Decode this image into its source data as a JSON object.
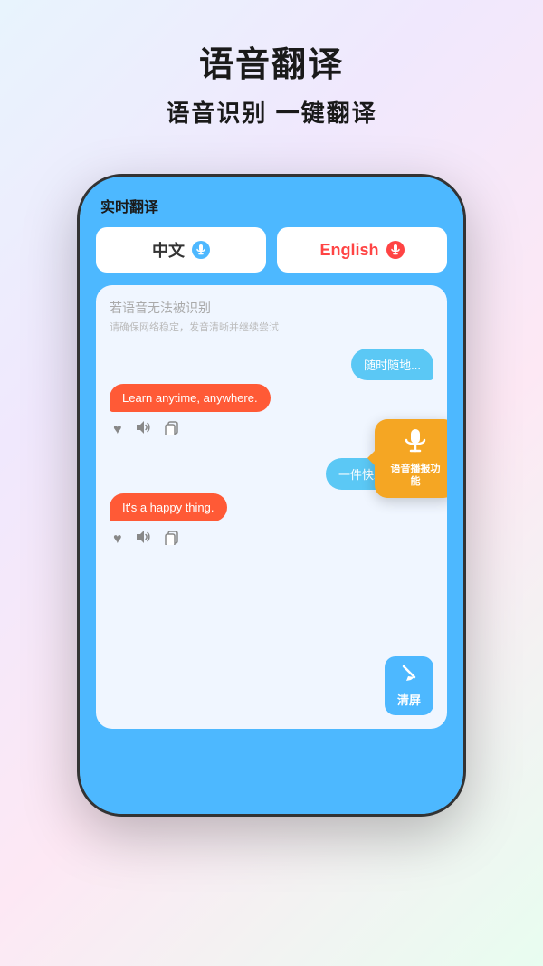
{
  "header": {
    "main_title": "语音翻译",
    "sub_title": "语音识别 一键翻译"
  },
  "app": {
    "title": "实时翻译",
    "lang_left": "中文",
    "lang_right": "English",
    "hint_primary": "若语音无法被识别",
    "hint_secondary": "请确保网络稳定，发音清晰并继续尝试",
    "msg1_right": "随时随地...",
    "msg1_left": "Learn anytime, anywhere.",
    "msg2_right": "一件快乐的事。",
    "msg2_left": "It's a happy thing.",
    "tooltip_text": "语音播报功能",
    "clear_btn": "清屏"
  }
}
